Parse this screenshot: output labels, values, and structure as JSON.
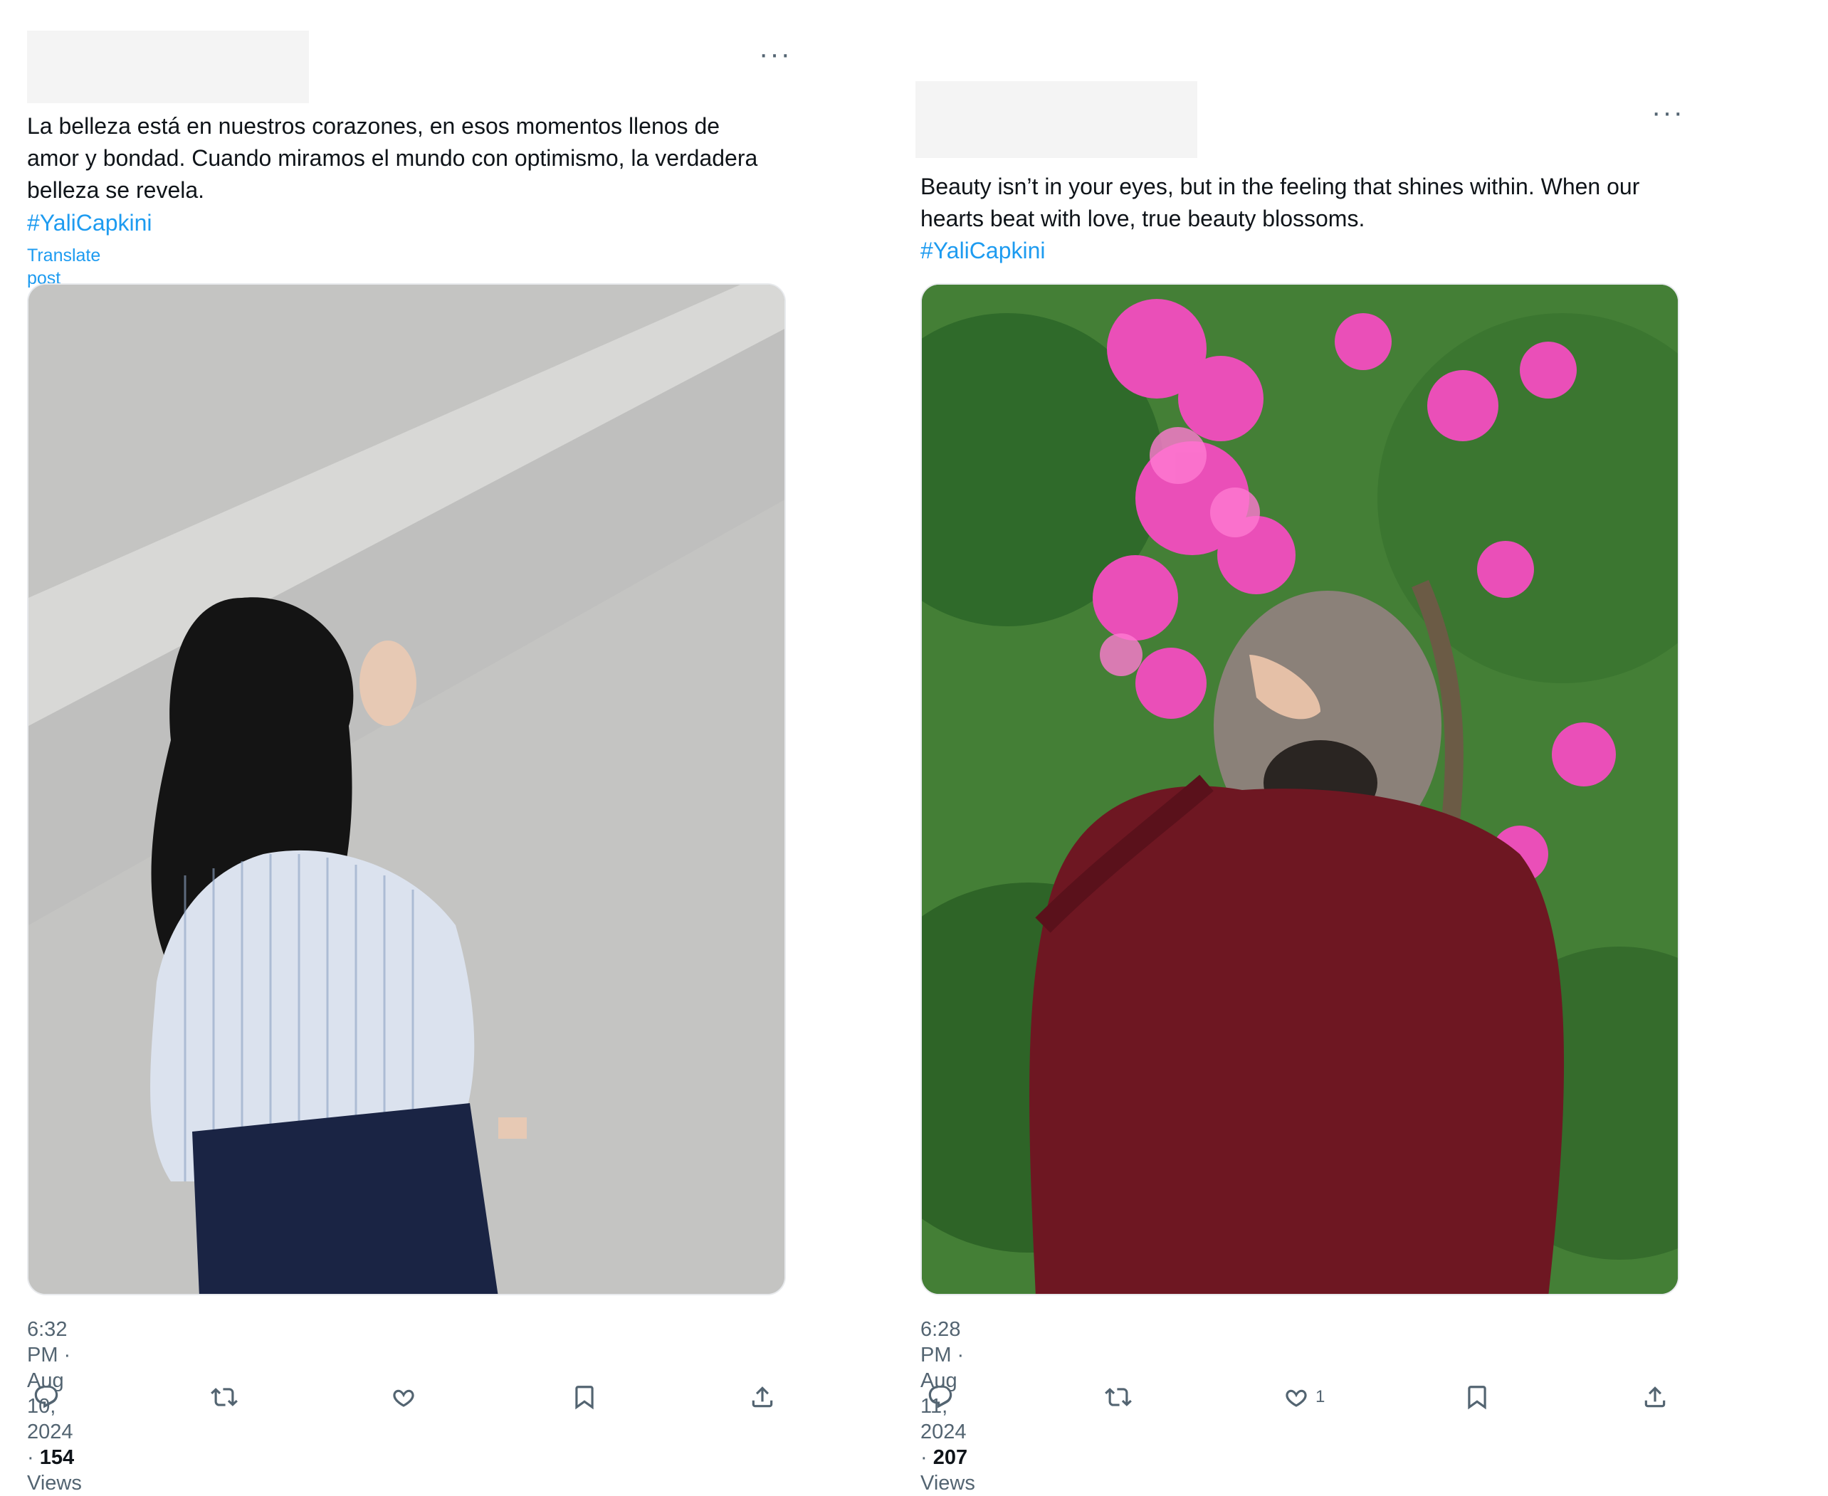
{
  "posts": [
    {
      "more_label": "···",
      "text_lines": [
        "La belleza está en nuestros corazones, en esos momentos llenos de",
        "amor y bondad. Cuando miramos el mundo con optimismo, la verdadera",
        "belleza se revela."
      ],
      "hashtag": "#YaliCapkini",
      "translate": "Translate post",
      "timestamp": "6:32 PM · Aug 10, 2024 · ",
      "views_count": "154",
      "views_label": " Views",
      "like_count": ""
    },
    {
      "more_label": "···",
      "text_lines": [
        "Beauty isn’t in your eyes, but in the feeling that shines within. When our",
        "hearts beat with love, true beauty blossoms."
      ],
      "hashtag": "#YaliCapkini",
      "timestamp": "6:28 PM · Aug 11, 2024 · ",
      "views_count": "207",
      "views_label": " Views",
      "like_count": "1"
    }
  ],
  "icons": [
    "reply-icon",
    "repost-icon",
    "like-icon",
    "bookmark-icon",
    "share-icon"
  ],
  "colors": {
    "accent": "#1d9bf0",
    "text": "#0f1419",
    "secondary": "#536471"
  }
}
